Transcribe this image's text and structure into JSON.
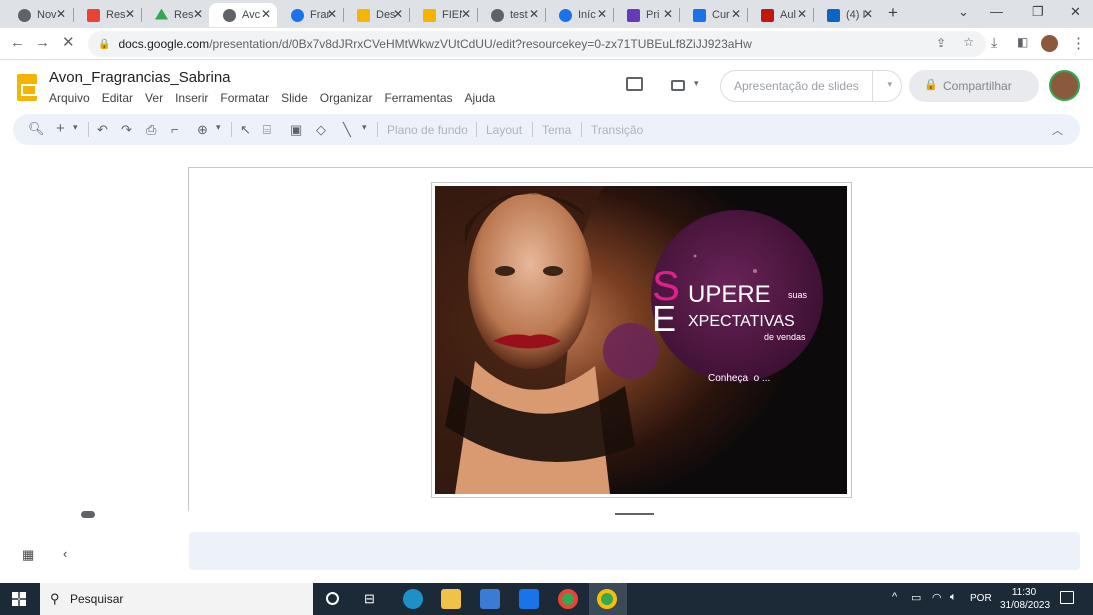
{
  "browser": {
    "tabs": [
      {
        "label": "Nov",
        "icon": "chrome-icon",
        "color": "#5f6368"
      },
      {
        "label": "Res",
        "icon": "gmail-icon",
        "color": "#ea4335"
      },
      {
        "label": "Res",
        "icon": "drive-icon",
        "color": "#34a853"
      },
      {
        "label": "Avc",
        "icon": "link-icon",
        "color": "#5f6368"
      },
      {
        "label": "Frar",
        "icon": "blue-circle-icon",
        "color": "#1a73e8"
      },
      {
        "label": "Des",
        "icon": "slides-icon",
        "color": "#f4b400"
      },
      {
        "label": "FIEN",
        "icon": "slides-icon",
        "color": "#f4b400"
      },
      {
        "label": "test",
        "icon": "globe-icon",
        "color": "#5f6368"
      },
      {
        "label": "Iníc",
        "icon": "edge-icon",
        "color": "#1a73e8"
      },
      {
        "label": "Pri",
        "icon": "forms-icon",
        "color": "#673ab7"
      },
      {
        "label": "Cur",
        "icon": "docs-icon",
        "color": "#1a73e8"
      },
      {
        "label": "Aul",
        "icon": "g1-icon",
        "color": "#c4170c"
      },
      {
        "label": "(4) I",
        "icon": "linkedin-icon",
        "color": "#0a66c2"
      }
    ],
    "url_host": "docs.google.com",
    "url_path": "/presentation/d/0Bx7v8dJRrxCVeHMtWkwzVUtCdUU/edit?resourcekey=0-zx71TUBEuLf8ZiJJ923aHw"
  },
  "app": {
    "title": "Avon_Fragrancias_Sabrina",
    "menus": [
      "Arquivo",
      "Editar",
      "Ver",
      "Inserir",
      "Formatar",
      "Slide",
      "Organizar",
      "Ferramentas",
      "Ajuda"
    ],
    "slideshow_label": "Apresentação de slides",
    "share_label": "Compartilhar",
    "toolbar_text": [
      "Plano de fundo",
      "Layout",
      "Tema",
      "Transição"
    ]
  },
  "slide": {
    "letter_s": "S",
    "word_upere": "UPERE",
    "word_suas": "suas",
    "letter_e": "E",
    "word_xpectativas": "XPECTATIVAS",
    "word_de_vendas": "de vendas",
    "cta": "Conheça  o ..."
  },
  "taskbar": {
    "search_label": "Pesquisar",
    "lang": "POR",
    "time": "11:30",
    "date": "31/08/2023"
  },
  "colors": {
    "accent_magenta": "#e0208a",
    "circle": "#5a1a48",
    "taskbar": "#1c2a38"
  }
}
